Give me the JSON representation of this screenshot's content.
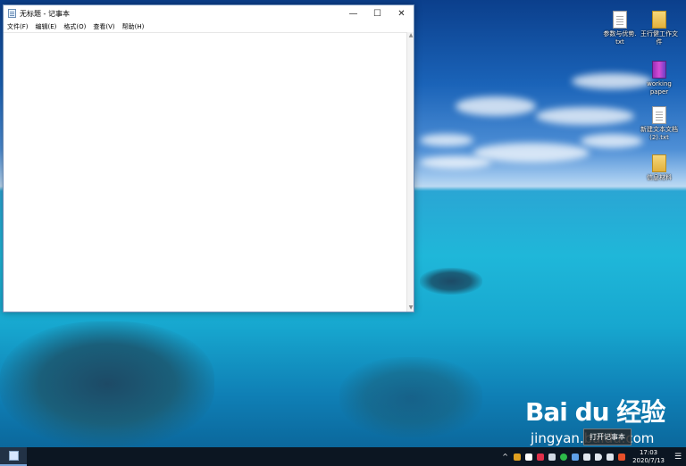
{
  "notepad": {
    "title": "无标题 - 记事本",
    "menu": [
      "文件(F)",
      "编辑(E)",
      "格式(O)",
      "查看(V)",
      "帮助(H)"
    ],
    "controls": {
      "minimize": "—",
      "maximize": "☐",
      "close": "✕"
    },
    "scroll_up": "▲",
    "scroll_down": "▼"
  },
  "desktop_icons": [
    {
      "label_line1": "参数与优势.",
      "label_line2": "txt",
      "type": "doc"
    },
    {
      "label_line1": "王行健工作文",
      "label_line2": "件",
      "type": "folder"
    },
    {
      "label_line1": "working",
      "label_line2": "paper",
      "type": "rar"
    },
    {
      "label_line1": "新建文本文档",
      "label_line2": "(2).txt",
      "type": "doc"
    },
    {
      "label_line1": "信息材料",
      "label_line2": "",
      "type": "folder"
    }
  ],
  "watermark": {
    "logo": "Bai du 经验",
    "url": "jingyan.baidu.com"
  },
  "tooltip": "打开记事本",
  "taskbar": {
    "tray_arrow": "^",
    "clock_time": "17:03",
    "clock_date": "2020/7/13",
    "notification_icon": "☰"
  }
}
